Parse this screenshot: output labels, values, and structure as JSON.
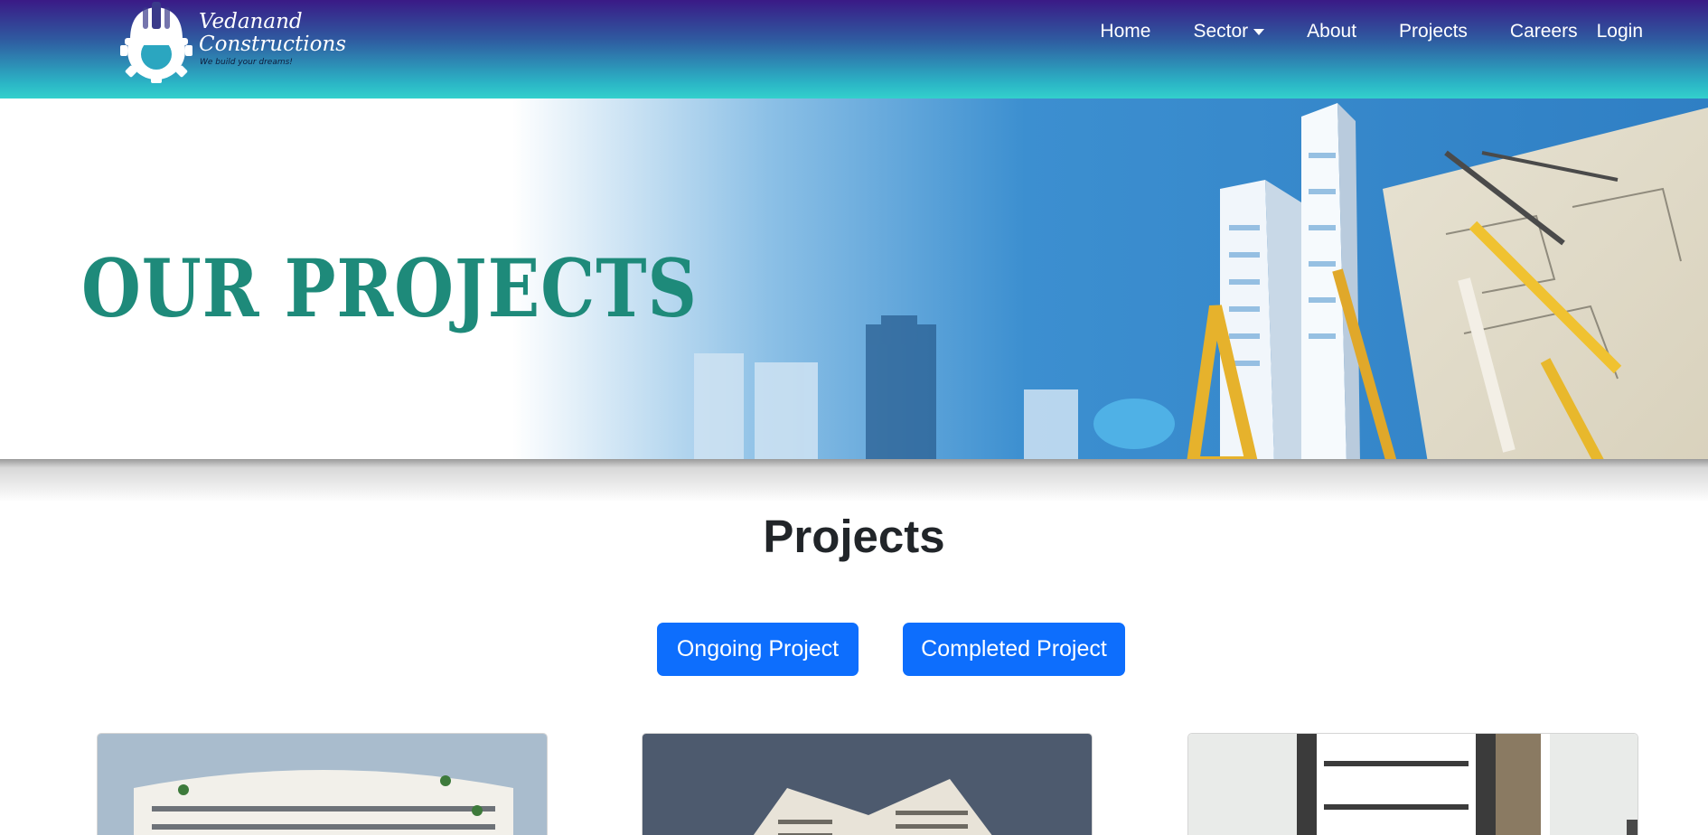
{
  "brand": {
    "name": "Vedanand\nConstructions",
    "tagline": "We build your dreams!"
  },
  "nav": {
    "items": [
      {
        "label": "Home"
      },
      {
        "label": "Sector"
      },
      {
        "label": "About"
      },
      {
        "label": "Projects"
      },
      {
        "label": "Careers"
      },
      {
        "label": "Login"
      }
    ]
  },
  "banner": {
    "title": "OUR PROJECTS"
  },
  "main": {
    "heading": "Projects",
    "buttons": {
      "ongoing": "Ongoing Project",
      "completed": "Completed Project"
    }
  },
  "colors": {
    "primary_button": "#0d6efd",
    "banner_title": "#1e8a7a",
    "nav_gradient_top": "#3a1a86",
    "nav_gradient_bottom": "#33d0cc"
  },
  "icons": {
    "logo": "helmet-gear-icon",
    "dropdown": "caret-down-icon"
  }
}
